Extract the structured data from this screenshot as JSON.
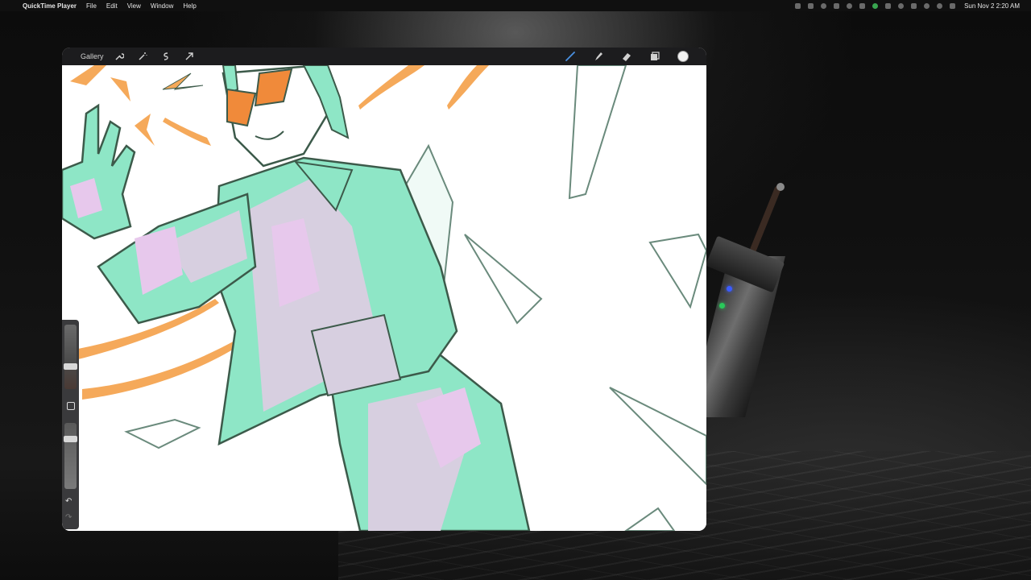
{
  "menubar": {
    "app_name": "QuickTime Player",
    "menus": [
      "File",
      "Edit",
      "View",
      "Window",
      "Help"
    ],
    "datetime": "Sun Nov 2  2:20 AM",
    "status_icons": [
      "screen-record-icon",
      "display-icon",
      "extension-icon",
      "control-icon",
      "notification-icon",
      "vpn-icon",
      "app-status-icon",
      "arrow-icon",
      "play-icon",
      "wifi-icon",
      "moon-icon",
      "siri-icon",
      "control-center-icon"
    ]
  },
  "app": {
    "gallery_label": "Gallery",
    "left_tools": [
      "wrench-icon",
      "magic-wand-icon",
      "selection-icon",
      "transform-arrow-icon"
    ],
    "right_tools": [
      "brush-icon",
      "smudge-icon",
      "eraser-icon",
      "layers-icon"
    ],
    "current_color": "#f2f2f2",
    "accent_brush_color": "#4a90e2"
  },
  "side_panel": {
    "undo_icon": "↶",
    "redo_icon": "↷"
  },
  "artwork": {
    "line_color": "#3c5a4a",
    "mint": "#8ee6c6",
    "pink": "#e7c8ec",
    "lavender": "#d7cfe0",
    "orange": "#f5a95a",
    "lens": "#f08a3a"
  }
}
